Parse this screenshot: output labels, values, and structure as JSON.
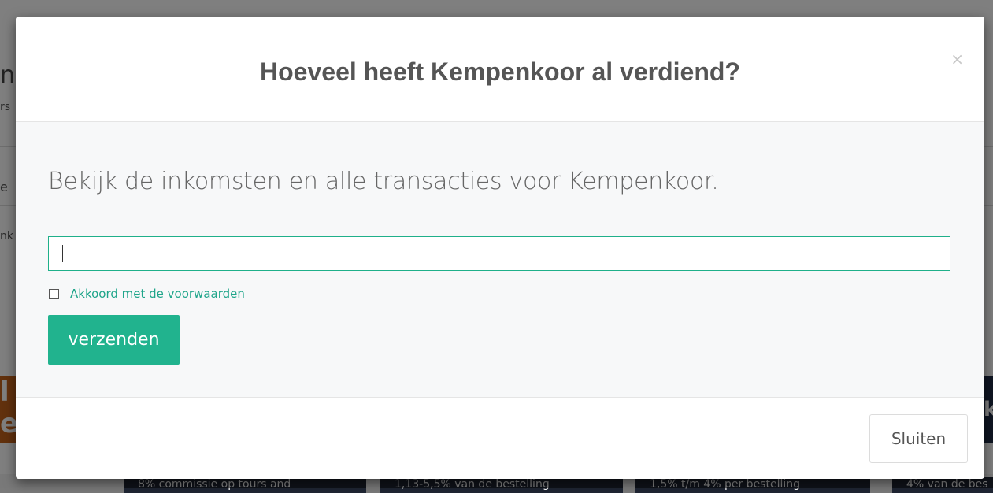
{
  "background": {
    "fragment_title": "n",
    "fragment_subtitle": "rs",
    "fragment_row1": "e",
    "fragment_row2": "nk",
    "banner_left": "l e",
    "banner_right": "k",
    "cards": [
      "8% commissie op tours and",
      "1,13-5,5% van de bestelling",
      "1,5% t/m 4% per bestelling",
      "4% van de bes"
    ]
  },
  "modal": {
    "title": "Hoeveel heeft Kempenkoor al verdiend?",
    "close_symbol": "×",
    "lead": "Bekijk de inkomsten en alle transacties voor Kempenkoor.",
    "input": {
      "value": "",
      "placeholder": ""
    },
    "checkbox": {
      "checked": false,
      "label": "Akkoord met de voorwaarden"
    },
    "submit_label": "verzenden",
    "footer_close_label": "Sluiten"
  },
  "colors": {
    "accent": "#21b38e",
    "link": "#1fa58a",
    "title_text": "#555555",
    "overlay": "rgba(0,0,0,0.5)"
  }
}
